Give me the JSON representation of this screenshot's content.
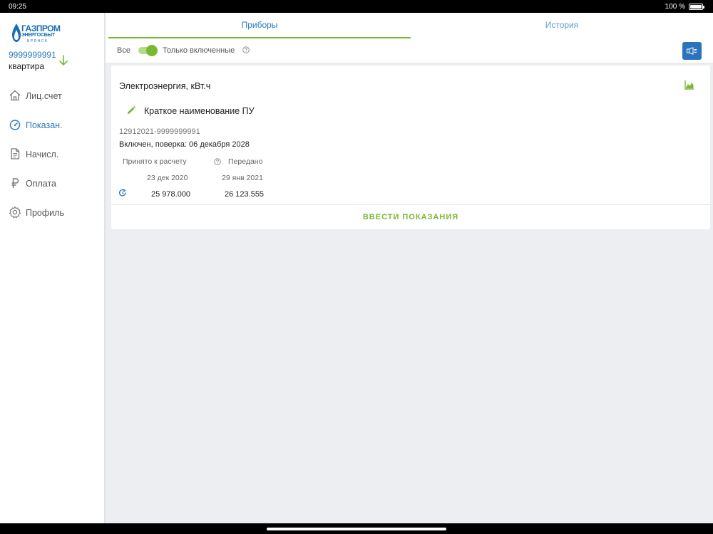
{
  "status_bar": {
    "time": "09:25",
    "battery": "100 %"
  },
  "logo": {
    "line1": "ГАЗПРОМ",
    "line2": "ЭНЕРГОСБЫТ",
    "line3": "БРЯНСК"
  },
  "account": {
    "number": "9999999991",
    "type": "квартира"
  },
  "nav": {
    "items": [
      {
        "label": "Лиц.счет",
        "icon": "home-icon"
      },
      {
        "label": "Показан.",
        "icon": "gauge-icon",
        "active": true
      },
      {
        "label": "Начисл.",
        "icon": "document-icon"
      },
      {
        "label": "Оплата",
        "icon": "ruble-icon"
      },
      {
        "label": "Профиль",
        "icon": "gear-icon"
      }
    ]
  },
  "tabs": [
    {
      "label": "Приборы"
    },
    {
      "label": "История"
    }
  ],
  "filter": {
    "all_label": "Все",
    "only_on_label": "Только включенные",
    "toggle_on": true
  },
  "card": {
    "title": "Электроэнергия, кВт.ч",
    "meter_name": "Краткое наименование ПУ",
    "serial": "12912021-9999999991",
    "status": "Включен, поверка: 06 декабря 2028",
    "accepted_header": "Принято к расчету",
    "sent_header": "Передано",
    "accepted_date": "23 дек 2020",
    "sent_date": "29 янв 2021",
    "accepted_value": "25 978.000",
    "sent_value": "26 123.555",
    "enter_button": "ВВЕСТИ ПОКАЗАНИЯ"
  },
  "colors": {
    "accent_green": "#7ab833",
    "accent_blue": "#2a7ab8",
    "button_blue": "#2a74bd"
  }
}
